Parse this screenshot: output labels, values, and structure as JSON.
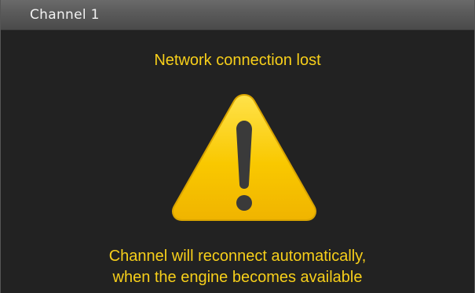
{
  "window": {
    "title": "Channel 1"
  },
  "status": {
    "headline": "Network connection lost",
    "icon": "warning-icon",
    "message_lines": [
      "Channel will reconnect automatically,",
      "when the engine becomes available"
    ]
  },
  "colors": {
    "background": "#222222",
    "titlebar": "#5a5a5a",
    "text_accent": "#f7cf1a",
    "icon_fill": "#f9c800",
    "icon_symbol": "#3a3a3a"
  }
}
